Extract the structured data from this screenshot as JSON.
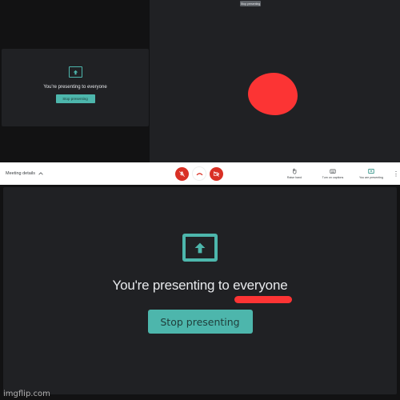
{
  "colors": {
    "accent": "#4db6ac",
    "danger": "#d93025",
    "annotation_red": "#fc3434",
    "panel_bg": "#202124",
    "toolbar_bg": "#ffffff"
  },
  "mini_preview": {
    "icon": "present-screen-icon",
    "message": "You're presenting to everyone",
    "button_label": "Stop presenting"
  },
  "participant_tile": {
    "tooltip": "Stop presenting",
    "annotation": "red-blob"
  },
  "toolbar": {
    "meeting_details_label": "Meeting details",
    "meeting_details_icon": "chevron-up-icon",
    "controls": [
      {
        "name": "microphone",
        "icon": "mic-off-icon",
        "state": "off"
      },
      {
        "name": "leave-call",
        "icon": "hang-up-icon"
      },
      {
        "name": "camera",
        "icon": "camera-off-icon",
        "state": "off"
      }
    ],
    "actions": [
      {
        "label": "Raise hand",
        "icon": "raise-hand-icon"
      },
      {
        "label": "Turn on captions",
        "icon": "captions-icon"
      },
      {
        "label": "You are presenting",
        "icon": "presenting-icon"
      }
    ],
    "more_icon": "more-vert-icon",
    "more_glyph": "⋮"
  },
  "main": {
    "icon": "present-screen-icon",
    "message": "You're presenting to everyone",
    "button_label": "Stop presenting"
  },
  "watermark": "imgflip.com"
}
